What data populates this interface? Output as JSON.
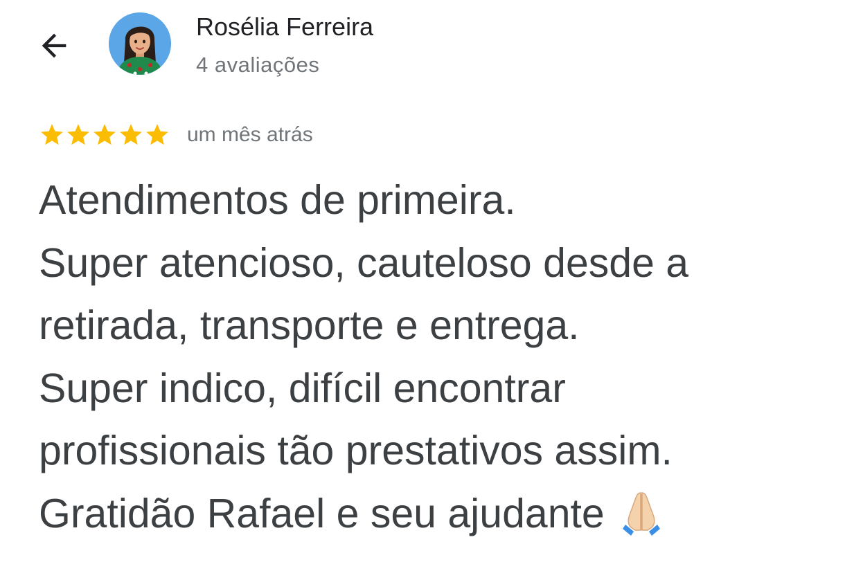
{
  "header": {
    "back_icon": "arrow-left-icon",
    "avatar_icon": "user-avatar-illustration",
    "user_name": "Rosélia Ferreira",
    "review_count": "4 avaliações"
  },
  "review": {
    "rating": 5,
    "rating_max": 5,
    "star_color": "#fbbc04",
    "time_ago": "um mês atrás",
    "lines": [
      "Atendimentos de primeira.",
      "Super atencioso, cauteloso desde a",
      "retirada, transporte e entrega.",
      "Super indico, difícil encontrar",
      "profissionais tão prestativos assim.",
      "Gratidão Rafael e seu ajudante"
    ],
    "trailing_emoji": "folded-hands-emoji"
  }
}
